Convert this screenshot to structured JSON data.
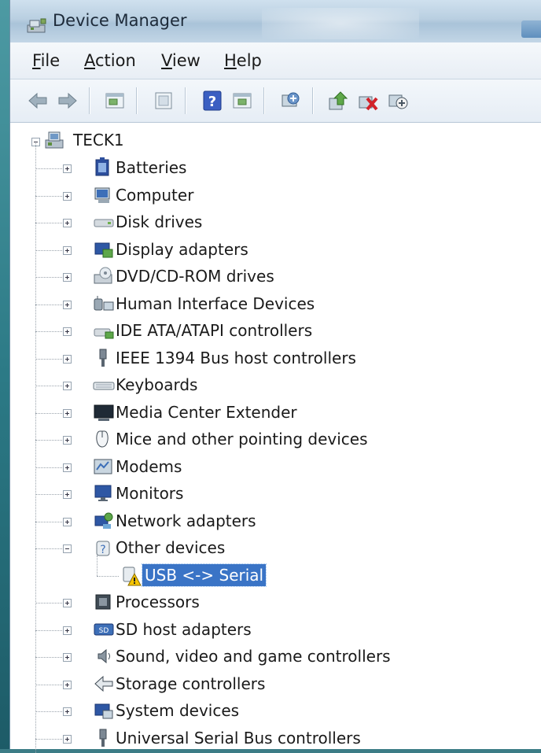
{
  "window": {
    "title": "Device Manager"
  },
  "menu": {
    "file": {
      "accel": "F",
      "rest": "ile"
    },
    "action": {
      "accel": "A",
      "rest": "ction"
    },
    "view": {
      "accel": "V",
      "rest": "iew"
    },
    "help": {
      "accel": "H",
      "rest": "elp"
    }
  },
  "toolbar": {
    "buttons": [
      "back-icon",
      "forward-icon",
      "show-hide-console-tree-icon",
      "properties-icon",
      "help-icon",
      "action-pane-icon",
      "scan-hardware-icon",
      "update-driver-icon",
      "uninstall-icon",
      "disable-icon"
    ]
  },
  "tree": {
    "root": "TECK1",
    "categories": [
      {
        "label": "Batteries",
        "icon": "battery-icon"
      },
      {
        "label": "Computer",
        "icon": "computer-icon"
      },
      {
        "label": "Disk drives",
        "icon": "disk-drive-icon"
      },
      {
        "label": "Display adapters",
        "icon": "display-adapter-icon"
      },
      {
        "label": "DVD/CD-ROM drives",
        "icon": "dvd-drive-icon"
      },
      {
        "label": "Human Interface Devices",
        "icon": "hid-icon"
      },
      {
        "label": "IDE ATA/ATAPI controllers",
        "icon": "ide-controller-icon"
      },
      {
        "label": "IEEE 1394 Bus host controllers",
        "icon": "ieee1394-icon"
      },
      {
        "label": "Keyboards",
        "icon": "keyboard-icon"
      },
      {
        "label": "Media Center Extender",
        "icon": "media-center-icon"
      },
      {
        "label": "Mice and other pointing devices",
        "icon": "mouse-icon"
      },
      {
        "label": "Modems",
        "icon": "modem-icon"
      },
      {
        "label": "Monitors",
        "icon": "monitor-icon"
      },
      {
        "label": "Network adapters",
        "icon": "network-adapter-icon"
      },
      {
        "label": "Other devices",
        "icon": "unknown-device-icon",
        "expanded": true
      },
      {
        "label": "Processors",
        "icon": "processor-icon"
      },
      {
        "label": "SD host adapters",
        "icon": "sd-adapter-icon"
      },
      {
        "label": "Sound, video and game controllers",
        "icon": "sound-icon"
      },
      {
        "label": "Storage controllers",
        "icon": "storage-controller-icon"
      },
      {
        "label": "System devices",
        "icon": "system-devices-icon"
      },
      {
        "label": "Universal Serial Bus controllers",
        "icon": "usb-controller-icon"
      }
    ],
    "other_devices_child": {
      "label": "USB <-> Serial",
      "icon": "warning-device-icon",
      "selected": true
    }
  },
  "colors": {
    "selection": "#3a74c6",
    "titlebar": "#b9cfe1"
  }
}
